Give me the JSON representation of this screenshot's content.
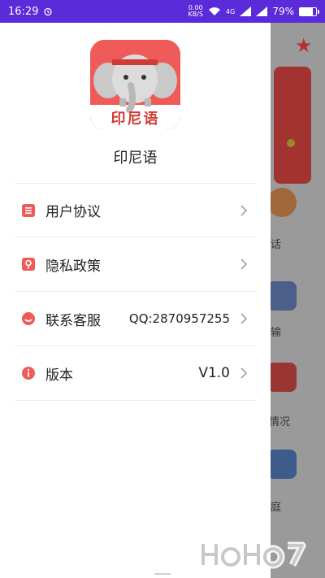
{
  "status_bar": {
    "time": "16:29",
    "net_speed": "0.00",
    "net_unit": "KB/S",
    "battery_percent": "79%",
    "battery_level": 0.79,
    "signal": "4G"
  },
  "drawer": {
    "logo_text": "印尼语",
    "app_name": "印尼语",
    "items": [
      {
        "label": "用户协议",
        "value": "",
        "icon": "document-icon"
      },
      {
        "label": "隐私政策",
        "value": "",
        "icon": "lock-icon"
      },
      {
        "label": "联系客服",
        "value": "QQ:2870957255",
        "icon": "chat-icon"
      },
      {
        "label": "版本",
        "value": "V1.0",
        "icon": "info-icon"
      }
    ]
  },
  "background": {
    "labels": [
      "话",
      "输",
      "情况",
      "庭"
    ]
  },
  "colors": {
    "accent": "#ef5b58",
    "status_bar": "#5b2bd9"
  }
}
